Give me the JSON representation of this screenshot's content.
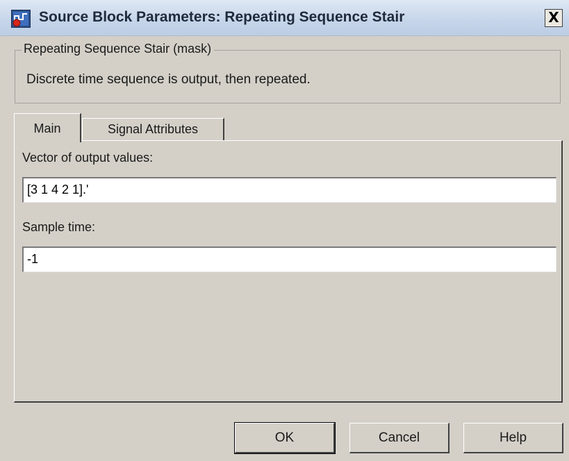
{
  "window": {
    "title": "Source Block Parameters: Repeating Sequence Stair",
    "icon": "simulink-block-icon",
    "close_label": "X"
  },
  "mask": {
    "legend": "Repeating Sequence Stair (mask)",
    "description": "Discrete time sequence is output, then repeated."
  },
  "tabs": [
    {
      "label": "Main",
      "selected": true
    },
    {
      "label": "Signal Attributes",
      "selected": false
    }
  ],
  "main": {
    "output_values_label": "Vector of output values:",
    "output_values_value": "[3 1 4 2 1].'",
    "sample_time_label": "Sample time:",
    "sample_time_value": "-1"
  },
  "buttons": {
    "ok": "OK",
    "cancel": "Cancel",
    "help": "Help"
  },
  "colors": {
    "face": "#d4d0c8",
    "title_bar": "#c7d6ea",
    "field_bg": "#ffffff"
  }
}
